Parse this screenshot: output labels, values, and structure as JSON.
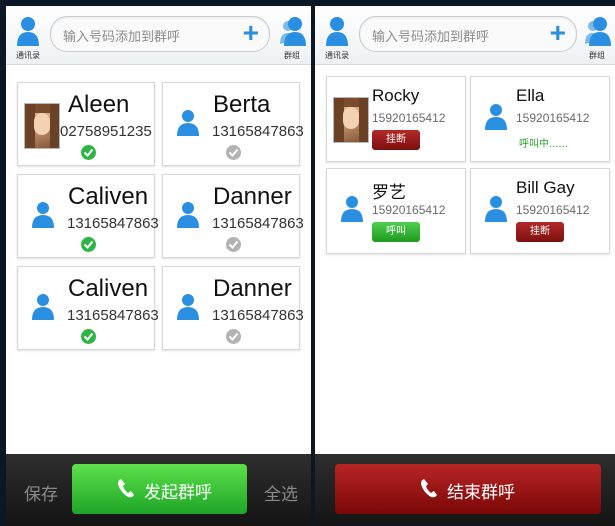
{
  "left": {
    "top": {
      "contacts_label": "通讯录",
      "search_placeholder": "输入号码添加到群呼",
      "add_symbol": "+",
      "group_label": "群组"
    },
    "contacts": [
      {
        "name": "Aleen",
        "phone": "02758951235",
        "selected": true,
        "photo": true
      },
      {
        "name": "Berta",
        "phone": "13165847863",
        "selected": false,
        "photo": false
      },
      {
        "name": "Caliven",
        "phone": "13165847863",
        "selected": true,
        "photo": false
      },
      {
        "name": "Danner",
        "phone": "13165847863",
        "selected": false,
        "photo": false
      },
      {
        "name": "Caliven",
        "phone": "13165847863",
        "selected": true,
        "photo": false
      },
      {
        "name": "Danner",
        "phone": "13165847863",
        "selected": false,
        "photo": false
      }
    ],
    "bottom": {
      "save_label": "保存",
      "start_label": "发起群呼",
      "select_all_label": "全选"
    }
  },
  "right": {
    "top": {
      "contacts_label": "通讯录",
      "search_placeholder": "输入号码添加到群呼",
      "add_symbol": "+",
      "group_label": "群组"
    },
    "contacts": [
      {
        "name": "Rocky",
        "phone": "15920165412",
        "status": "挂断",
        "status_kind": "red-button",
        "photo": true
      },
      {
        "name": "Ella",
        "phone": "15920165412",
        "status": "呼叫中......",
        "status_kind": "green-text",
        "photo": false
      },
      {
        "name": "罗艺",
        "phone": "15920165412",
        "status": "呼叫",
        "status_kind": "green-button",
        "photo": false
      },
      {
        "name": "Bill Gay",
        "phone": "15920165412",
        "status": "挂断",
        "status_kind": "red-button",
        "photo": false
      }
    ],
    "bottom": {
      "end_label": "结束群呼"
    }
  },
  "colors": {
    "accent_blue": "#2a8fe0",
    "check_green": "#2fb545",
    "start_green": "#1fa528",
    "end_red": "#7a0707"
  }
}
